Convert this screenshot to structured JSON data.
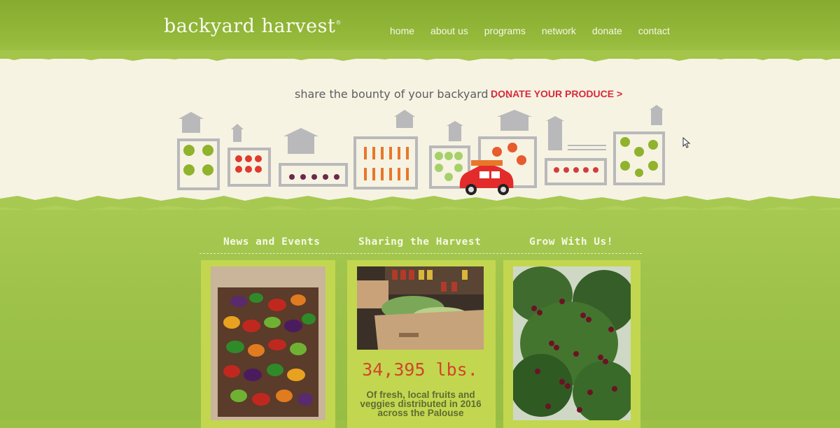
{
  "header": {
    "logo": "backyard harvest",
    "logo_mark": "®",
    "nav": [
      "home",
      "about us",
      "programs",
      "network",
      "donate",
      "contact"
    ]
  },
  "hero": {
    "tagline": "share the bounty of your backyard . . .",
    "donate_link": "DONATE YOUR PRODUCE >"
  },
  "columns": [
    {
      "title": "News and Events",
      "image": "box of mixed peppers"
    },
    {
      "title": "Sharing the Harvest",
      "image": "boxes of vegetables in pantry"
    },
    {
      "title": "Grow With Us!",
      "image": "cherry tree branches"
    }
  ],
  "stats": {
    "amount": "34,395 lbs.",
    "description": "Of fresh, local fruits and veggies distributed in 2016 across the Palouse"
  },
  "colors": {
    "header_green": "#86ab2e",
    "cream": "#f6f3e3",
    "donate_red": "#d9283a",
    "stat_red": "#d2452b"
  }
}
